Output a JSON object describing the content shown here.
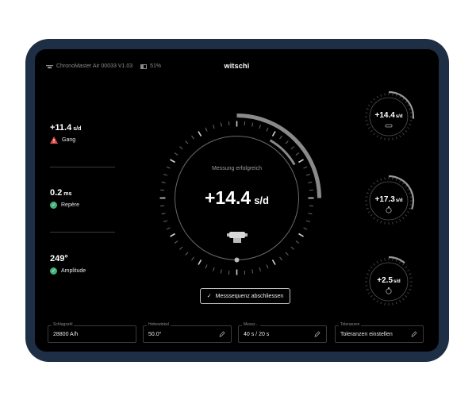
{
  "header": {
    "device": "ChronoMaster Air 00033 V1.03",
    "battery": "51%",
    "logo": "witschi"
  },
  "metrics": [
    {
      "value": "+11.4",
      "unit": "s/d",
      "label": "Gang",
      "status": "warning"
    },
    {
      "value": "0.2",
      "unit": "ms",
      "label": "Repère",
      "status": "ok"
    },
    {
      "value": "249°",
      "unit": "",
      "label": "Amplitude",
      "status": "ok"
    }
  ],
  "main_gauge": {
    "status_text": "Messung erfolgreich",
    "value": "+14.4",
    "unit": "s/d"
  },
  "confirm_button": {
    "label": "Messsequenz abschliessen"
  },
  "side_gauges": [
    {
      "value": "+14.4",
      "unit": "s/d",
      "icon": "watch-face-up-icon"
    },
    {
      "value": "+17.3",
      "unit": "s/d",
      "icon": "watch-crown-icon"
    },
    {
      "value": "+2.5",
      "unit": "s/d",
      "icon": "watch-crown-icon"
    }
  ],
  "fields": [
    {
      "label": "Schlagzahl",
      "value": "28800 A/h",
      "editable": false
    },
    {
      "label": "Hebewinkel",
      "value": "50.0°",
      "editable": true
    },
    {
      "label": "Messz...",
      "value": "40 s / 20 s",
      "editable": true
    },
    {
      "label": "Toleranzen",
      "value": "Toleranzen einstellen",
      "editable": true
    }
  ],
  "colors": {
    "frame": "#1d2e45",
    "screen": "#000000",
    "ok": "#41b37a",
    "warning": "#e04b4b",
    "arc": "#8a8a8a"
  }
}
